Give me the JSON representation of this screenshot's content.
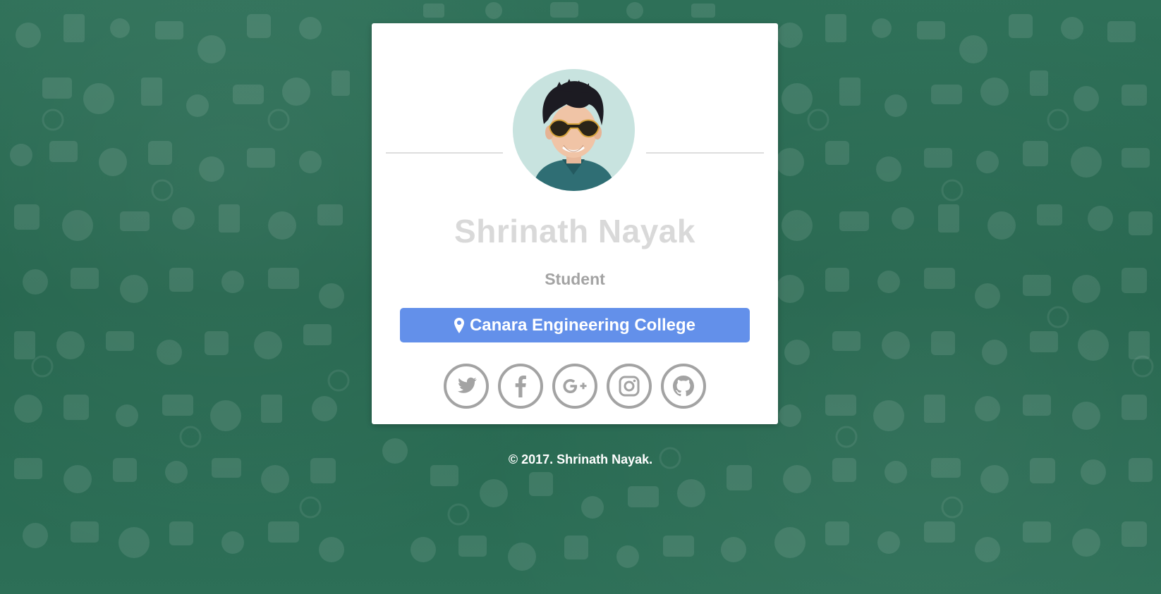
{
  "profile": {
    "name": "Shrinath Nayak",
    "role": "Student",
    "location": "Canara Engineering College"
  },
  "socials": [
    {
      "icon": "twitter-icon"
    },
    {
      "icon": "facebook-icon"
    },
    {
      "icon": "google-plus-icon"
    },
    {
      "icon": "instagram-icon"
    },
    {
      "icon": "github-icon"
    }
  ],
  "footer": {
    "text": "© 2017. Shrinath Nayak."
  },
  "colors": {
    "background": "#2c6d56",
    "card": "#ffffff",
    "name": "#d9d9d9",
    "role": "#a3a3a3",
    "location_button": "#6390ea",
    "social_ring": "#a3a3a3"
  }
}
